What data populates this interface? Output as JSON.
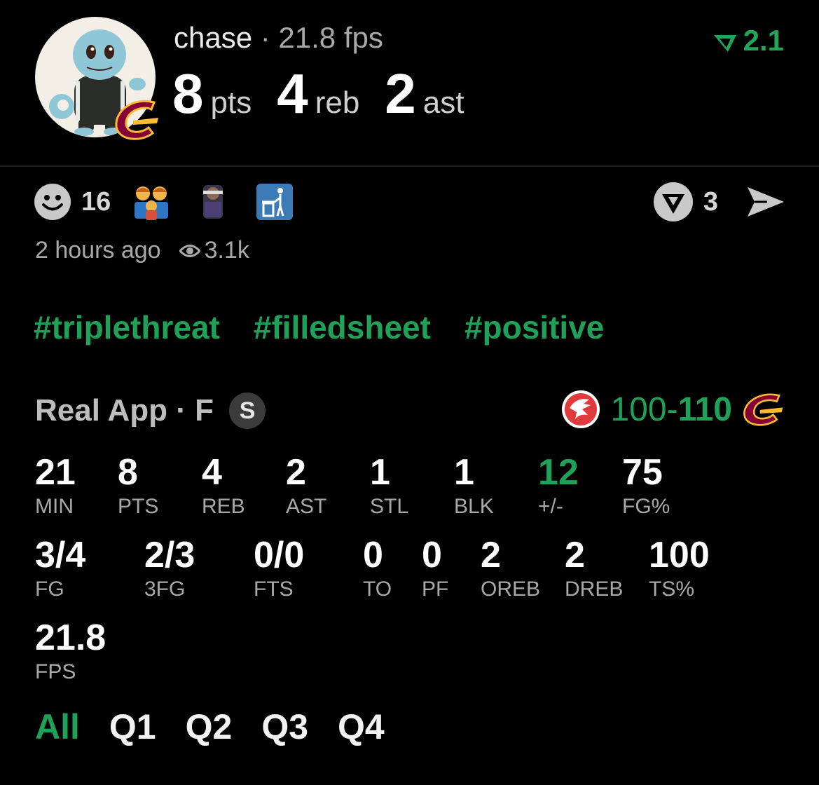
{
  "header": {
    "username": "chase",
    "separator": "·",
    "fps_text": "21.8 fps",
    "points": "8",
    "points_unit": "pts",
    "rebounds": "4",
    "rebounds_unit": "reb",
    "assists": "2",
    "assists_unit": "ast",
    "rating": "2.1",
    "colors": {
      "accent": "#1fa15a",
      "team_wine": "#860038",
      "team_gold": "#FDBB30"
    }
  },
  "reactions": {
    "smile_count": "16",
    "icons": [
      "smiley-icon",
      "family-emoji-icon",
      "player-sticker-icon",
      "trash-icon"
    ],
    "comment_count": "3"
  },
  "meta": {
    "time": "2 hours ago",
    "views": "3.1k"
  },
  "tags": [
    "#triplethreat",
    "#filledsheet",
    "#positive"
  ],
  "game": {
    "title": "Real App · F",
    "badge": "S",
    "away_score": "100",
    "dash": "-",
    "home_score": "110"
  },
  "stats_row1": [
    {
      "v": "21",
      "l": "MIN"
    },
    {
      "v": "8",
      "l": "PTS"
    },
    {
      "v": "4",
      "l": "REB"
    },
    {
      "v": "2",
      "l": "AST"
    },
    {
      "v": "1",
      "l": "STL"
    },
    {
      "v": "1",
      "l": "BLK"
    },
    {
      "v": "12",
      "l": "+/-"
    },
    {
      "v": "75",
      "l": "FG%"
    }
  ],
  "stats_row2": [
    {
      "v": "3/4",
      "l": "FG"
    },
    {
      "v": "2/3",
      "l": "3FG"
    },
    {
      "v": "0/0",
      "l": "FTS"
    },
    {
      "v": "0",
      "l": "TO"
    },
    {
      "v": "0",
      "l": "PF"
    },
    {
      "v": "2",
      "l": "OREB"
    },
    {
      "v": "2",
      "l": "DREB"
    },
    {
      "v": "100",
      "l": "TS%"
    }
  ],
  "stats_row3": [
    {
      "v": "21.8",
      "l": "FPS"
    }
  ],
  "quarters": [
    "All",
    "Q1",
    "Q2",
    "Q3",
    "Q4"
  ]
}
